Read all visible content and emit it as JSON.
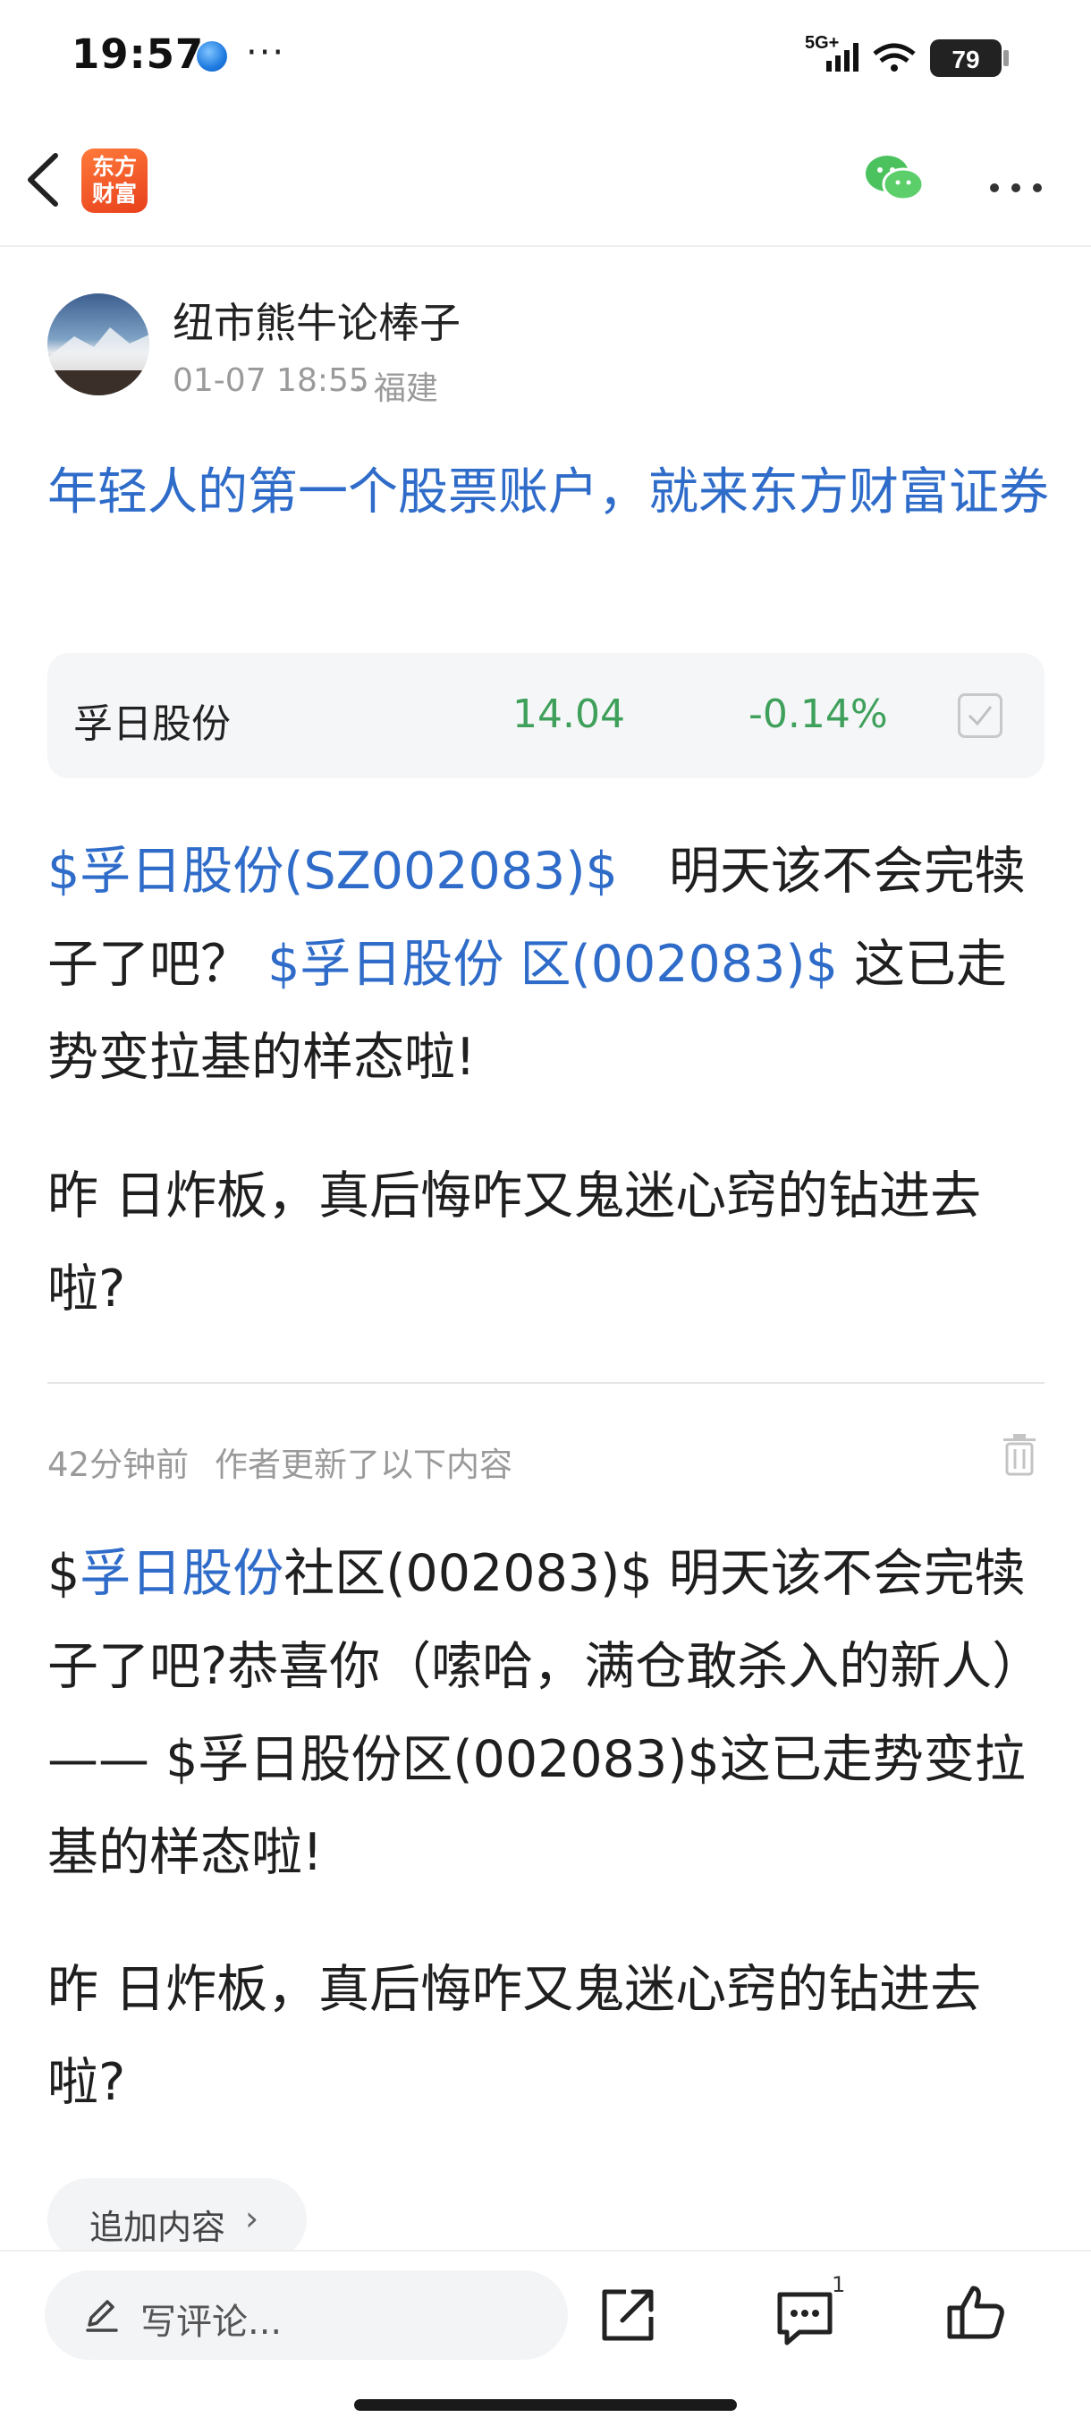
{
  "status_bar": {
    "time": "19:57",
    "more": "···",
    "network": "5G+",
    "battery": "79"
  },
  "nav": {
    "logo_line1": "东方",
    "logo_line2": "财富",
    "icons": [
      "back-icon",
      "wechat-icon",
      "more-icon"
    ]
  },
  "author": {
    "name": "纽市熊牛论棒子",
    "time": "01-07 18:55",
    "location": "· 福建"
  },
  "promo": {
    "text": "年轻人的第一个股票账户，就来东方财富证券"
  },
  "stock": {
    "name": "孚日股份",
    "price": "14.04",
    "change": "-0.14%"
  },
  "post": {
    "p1_link1": "$孚日股份(SZ002083)$",
    "p1_text1": "　明天该不会完犊子了吧？ ",
    "p1_link2": "$孚日股份 区(002083)$",
    "p1_text2": " 这已走势变拉基的样态啦!",
    "p2": "昨 日炸板，真后悔咋又鬼迷心窍的钻进去啦?"
  },
  "update": {
    "time": "42分钟前",
    "note": "作者更新了以下内容",
    "p3_prefix": "$",
    "p3_link": "孚日股份",
    "p3_rest": "社区(002083)$ 明天该不会完犊子了吧?恭喜你（嗦哈，满仓敢杀入的新人）—— $孚日股份区(002083)$这已走势变拉基的样态啦!",
    "p4": "昨 日炸板，真后悔咋又鬼迷心窍的钻进去啦?",
    "append_label": "追加内容",
    "append_chevron": "›"
  },
  "bottom_bar": {
    "comment_placeholder": "写评论...",
    "comment_count": "1"
  },
  "colors": {
    "link": "#2f6cc9",
    "stock_green": "#3ea05a",
    "brand_orange": "#e8401c"
  }
}
